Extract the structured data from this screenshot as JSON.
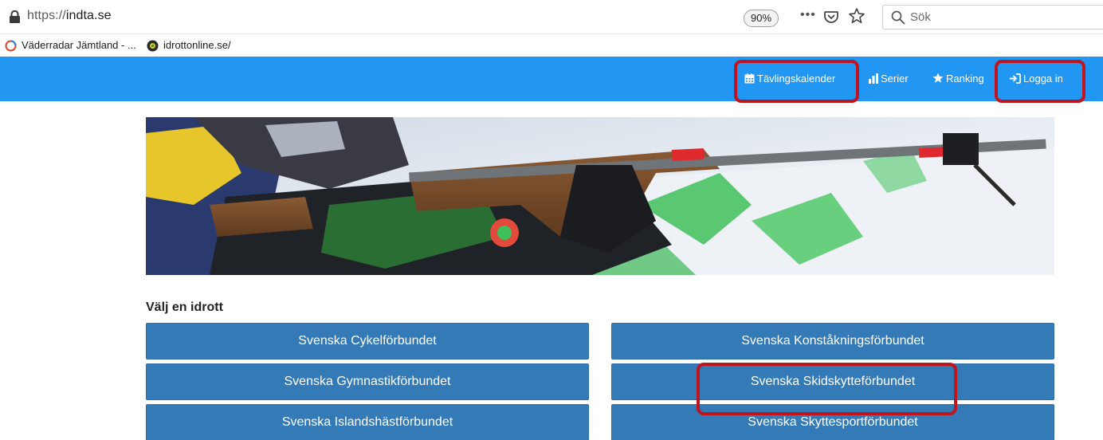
{
  "browser": {
    "url_scheme": "https://",
    "url_host": "indta.se",
    "zoom": "90%",
    "more": "•••",
    "search_placeholder": "Sök",
    "icons": [
      "lock-icon",
      "page-actions-icon",
      "pocket-icon",
      "bookmark-star-icon",
      "search-icon"
    ]
  },
  "bookmarks": [
    {
      "label": "Väderradar Jämtland - ...",
      "icon": "radar-icon"
    },
    {
      "label": "idrottonline.se/",
      "icon": "globe-icon"
    }
  ],
  "nav": {
    "calendar": "Tävlingskalender",
    "series": "Serier",
    "ranking": "Ranking",
    "login": "Logga in",
    "color": "#2196f3",
    "highlight_color": "#c0141e"
  },
  "section": {
    "heading": "Välj en idrott"
  },
  "sports": {
    "left": [
      "Svenska Cykelförbundet",
      "Svenska Gymnastikförbundet",
      "Svenska Islandshästförbundet"
    ],
    "right": [
      "Svenska Konståkningsförbundet",
      "Svenska Skidskytteförbundet",
      "Svenska Skyttesportförbundet"
    ],
    "button_color": "#337ab7"
  }
}
